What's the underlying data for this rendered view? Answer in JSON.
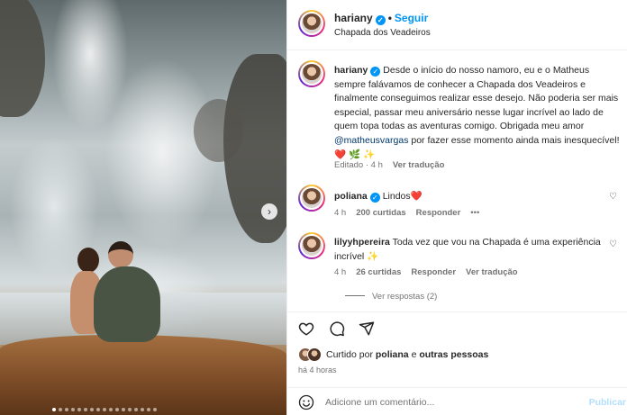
{
  "post": {
    "username": "hariany",
    "follow_label": "Seguir",
    "separator": "•",
    "location": "Chapada dos Veadeiros"
  },
  "caption": {
    "username": "hariany",
    "text_before_mention": "Desde o início do nosso namoro, eu e o Matheus sempre falávamos de conhecer a Chapada dos Veadeiros e finalmente conseguimos realizar esse desejo. Não poderia ser mais especial, passar meu aniversário nesse lugar incrível ao lado de quem topa todas as aventuras comigo. Obrigada meu amor",
    "mention": "@matheusvargas",
    "text_after_mention": "por fazer esse momento ainda mais inesquecível! ❤️ 🌿 ✨",
    "edited": "Editado · 4 h",
    "translate": "Ver tradução"
  },
  "comments": [
    {
      "username": "poliana",
      "verified": true,
      "text": "Lindos❤️",
      "time": "4 h",
      "likes": "200 curtidas",
      "reply": "Responder",
      "more": "•••"
    },
    {
      "username": "lilyyhpereira",
      "verified": false,
      "text": "Toda vez que vou na Chapada é uma experiência incrível ✨",
      "time": "4 h",
      "likes": "26 curtidas",
      "reply": "Responder",
      "translate": "Ver tradução",
      "view_replies": "Ver respostas (2)"
    }
  ],
  "liked_by": {
    "prefix": "Curtido por",
    "user": "poliana",
    "conj": "e",
    "others": "outras pessoas"
  },
  "time_ago": "há 4 horas",
  "comment_box": {
    "placeholder": "Adicione um comentário...",
    "publish": "Publicar"
  },
  "icons": {
    "like": "heart-icon",
    "comment": "comment-icon",
    "share": "send-icon",
    "emoji": "emoji-icon",
    "next": "chevron-right-icon"
  },
  "colors": {
    "accent": "#0095f6",
    "link": "#00376b",
    "muted": "#737373",
    "text": "#262626"
  }
}
